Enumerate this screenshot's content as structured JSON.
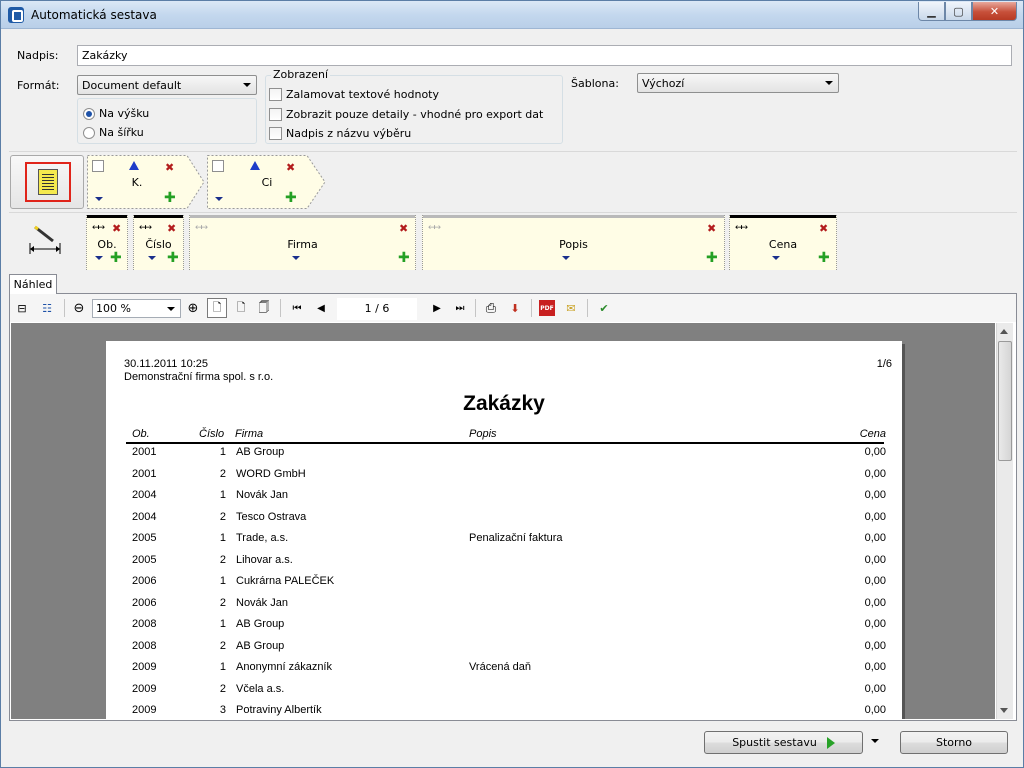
{
  "window": {
    "title": "Automatická sestava"
  },
  "form": {
    "nadpis_label": "Nadpis:",
    "nadpis_value": "Zakázky",
    "format_label": "Formát:",
    "format_value": "Document default",
    "orientation_portrait": "Na výšku",
    "orientation_landscape": "Na šířku",
    "zobrazeni_title": "Zobrazení",
    "chk_wrap": "Zalamovat textové hodnoty",
    "chk_details": "Zobrazit pouze detaily - vhodné pro export dat",
    "chk_title": "Nadpis z názvu výběru",
    "sablona_label": "Šablona:",
    "sablona_value": "Výchozí"
  },
  "groups": [
    {
      "label": "K."
    },
    {
      "label": "Ci"
    }
  ],
  "columns": [
    {
      "label": "Ob."
    },
    {
      "label": "Číslo"
    },
    {
      "label": "Firma"
    },
    {
      "label": "Popis"
    },
    {
      "label": "Cena"
    }
  ],
  "tabs": {
    "preview": "Náhled"
  },
  "toolbar": {
    "zoom": "100 %",
    "page_indicator": "1 / 6"
  },
  "report": {
    "date": "30.11.2011 10:25",
    "company": "Demonstrační firma spol. s r.o.",
    "page": "1/6",
    "title": "Zakázky",
    "headers": {
      "ob": "Ob.",
      "cislo": "Číslo",
      "firma": "Firma",
      "popis": "Popis",
      "cena": "Cena"
    },
    "rows": [
      {
        "ob": "2001",
        "cislo": "1",
        "firma": "AB Group",
        "popis": "",
        "cena": "0,00"
      },
      {
        "ob": "2001",
        "cislo": "2",
        "firma": "WORD GmbH",
        "popis": "",
        "cena": "0,00"
      },
      {
        "ob": "2004",
        "cislo": "1",
        "firma": "Novák Jan",
        "popis": "",
        "cena": "0,00"
      },
      {
        "ob": "2004",
        "cislo": "2",
        "firma": "Tesco Ostrava",
        "popis": "",
        "cena": "0,00"
      },
      {
        "ob": "2005",
        "cislo": "1",
        "firma": "Trade, a.s.",
        "popis": "Penalizační faktura",
        "cena": "0,00"
      },
      {
        "ob": "2005",
        "cislo": "2",
        "firma": "Lihovar a.s.",
        "popis": "",
        "cena": "0,00"
      },
      {
        "ob": "2006",
        "cislo": "1",
        "firma": "Cukrárna PALEČEK",
        "popis": "",
        "cena": "0,00"
      },
      {
        "ob": "2006",
        "cislo": "2",
        "firma": "Novák Jan",
        "popis": "",
        "cena": "0,00"
      },
      {
        "ob": "2008",
        "cislo": "1",
        "firma": "AB Group",
        "popis": "",
        "cena": "0,00"
      },
      {
        "ob": "2008",
        "cislo": "2",
        "firma": "AB Group",
        "popis": "",
        "cena": "0,00"
      },
      {
        "ob": "2009",
        "cislo": "1",
        "firma": "Anonymní zákazník",
        "popis": "Vrácená daň",
        "cena": "0,00"
      },
      {
        "ob": "2009",
        "cislo": "2",
        "firma": "Včela a.s.",
        "popis": "",
        "cena": "0,00"
      },
      {
        "ob": "2009",
        "cislo": "3",
        "firma": "Potraviny Albertík",
        "popis": "",
        "cena": "0,00"
      }
    ]
  },
  "buttons": {
    "run": "Spustit sestavu",
    "cancel": "Storno"
  }
}
